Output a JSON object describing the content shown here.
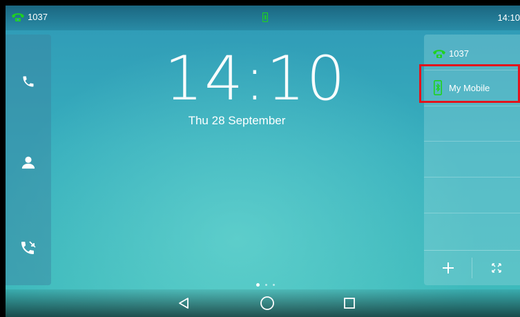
{
  "status_bar": {
    "account": "1037",
    "time": "14:10",
    "center_icon": "mobile-bluetooth-icon"
  },
  "left_dock": {
    "buttons": [
      {
        "icon": "phone-icon"
      },
      {
        "icon": "contacts-icon"
      },
      {
        "icon": "call-history-icon"
      }
    ]
  },
  "clock": {
    "time": "14:10",
    "date": "Thu 28 September"
  },
  "right_panel": {
    "account_label": "1037",
    "mobile_label": "My Mobile",
    "footer": {
      "add_icon": "plus-icon",
      "expand_icon": "expand-icon"
    }
  },
  "page_indicator": {
    "count": 3,
    "active": 1
  },
  "nav_bar": {
    "back_icon": "back-triangle-icon",
    "home_icon": "home-circle-icon",
    "recent_icon": "recent-square-icon"
  },
  "colors": {
    "accent_green": "#1fd21f",
    "highlight_red": "#e3141c",
    "background_top": "#2f99b6",
    "background_bottom": "#3fbcbc"
  }
}
